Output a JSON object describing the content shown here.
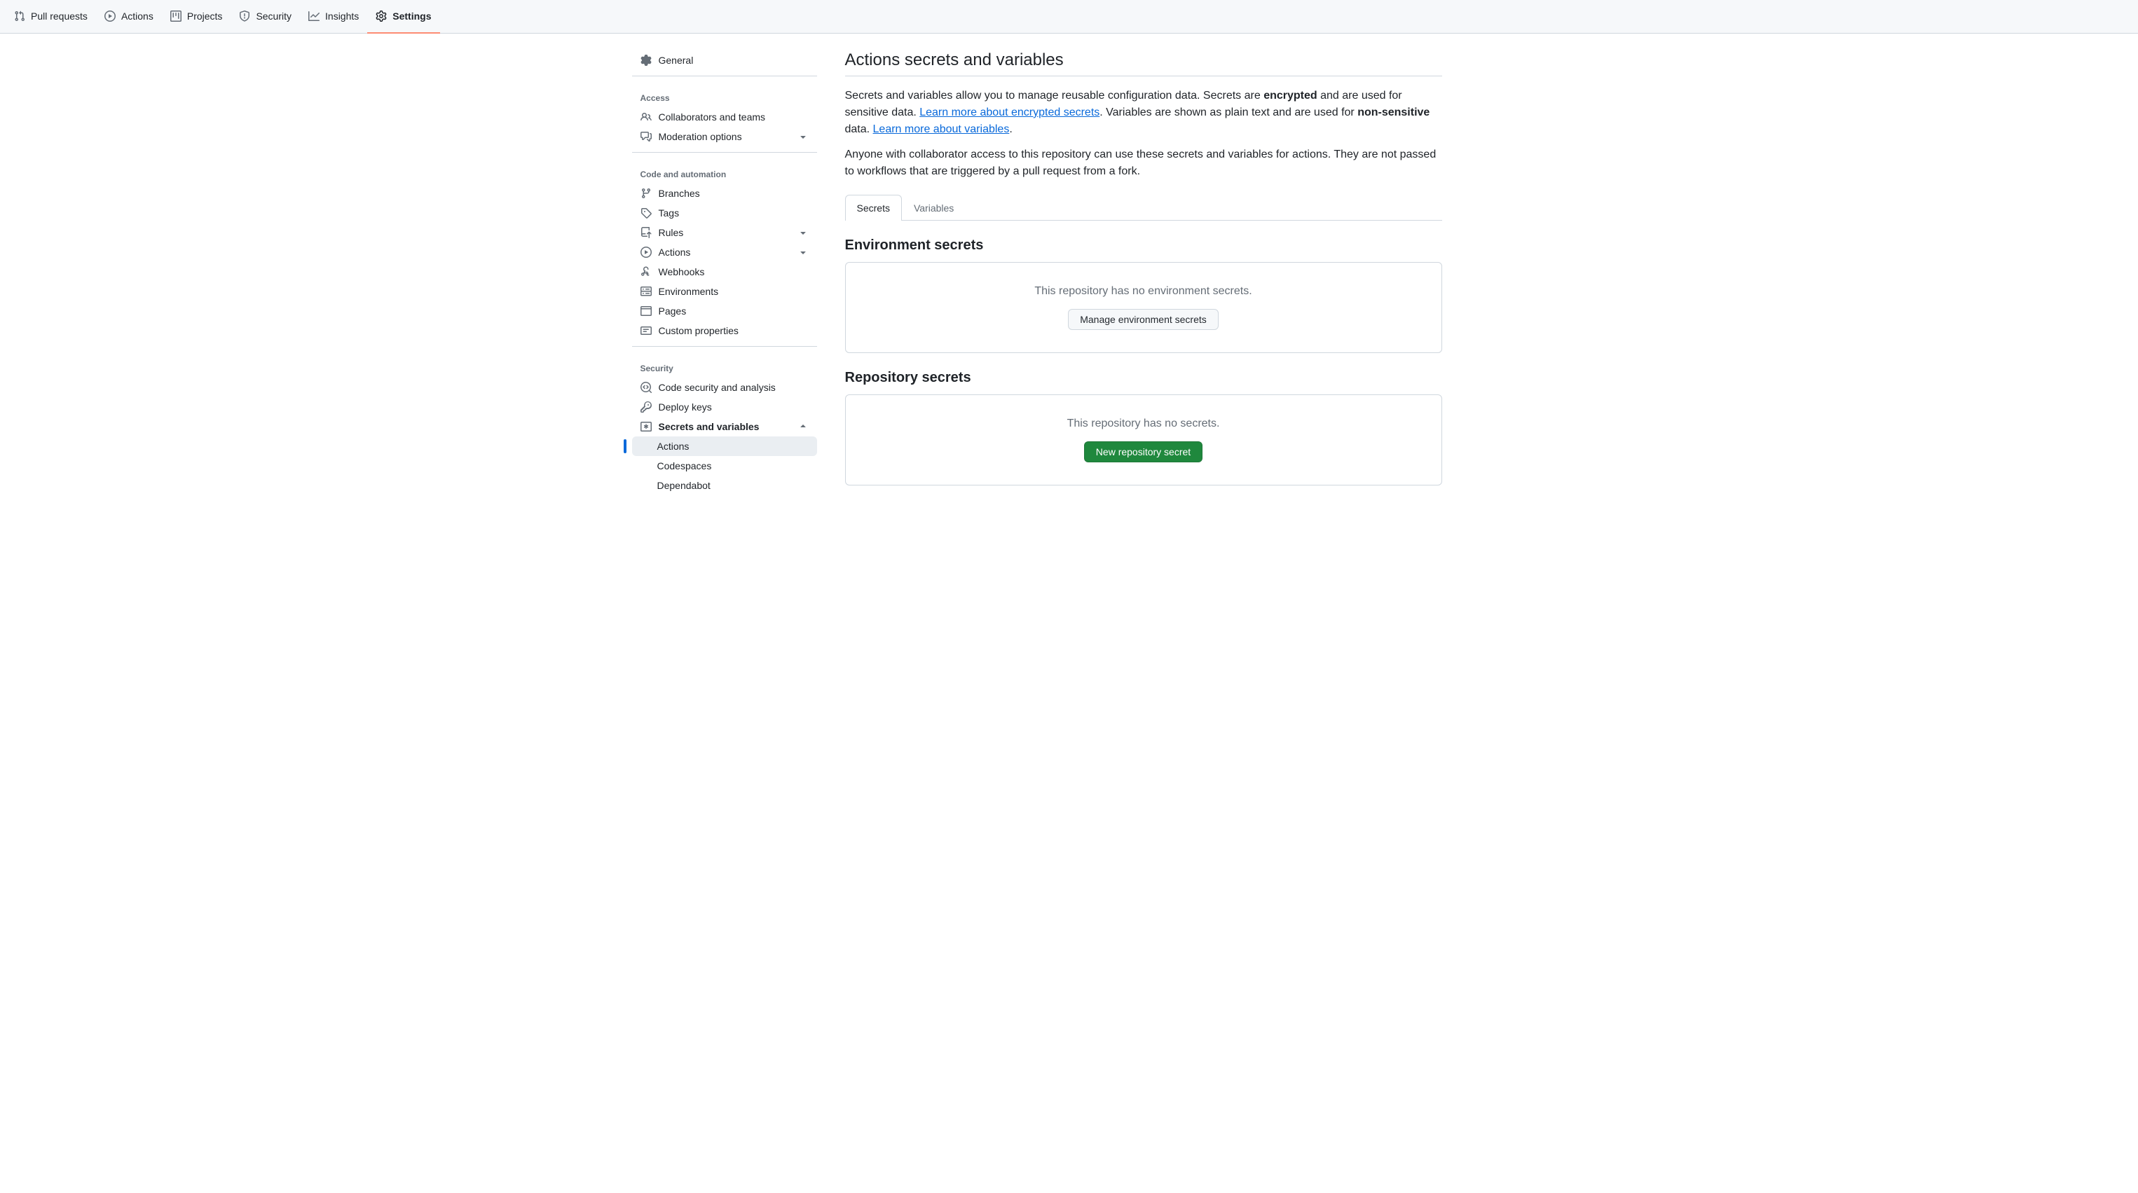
{
  "topnav": {
    "pull_requests": "Pull requests",
    "actions": "Actions",
    "projects": "Projects",
    "security": "Security",
    "insights": "Insights",
    "settings": "Settings"
  },
  "sidebar": {
    "general": "General",
    "group_access": "Access",
    "collaborators": "Collaborators and teams",
    "moderation": "Moderation options",
    "group_code": "Code and automation",
    "branches": "Branches",
    "tags": "Tags",
    "rules": "Rules",
    "actions": "Actions",
    "webhooks": "Webhooks",
    "environments": "Environments",
    "pages": "Pages",
    "custom_properties": "Custom properties",
    "group_security": "Security",
    "code_security": "Code security and analysis",
    "deploy_keys": "Deploy keys",
    "secrets_vars": "Secrets and variables",
    "sv_actions": "Actions",
    "sv_codespaces": "Codespaces",
    "sv_dependabot": "Dependabot"
  },
  "main": {
    "title": "Actions secrets and variables",
    "p1_a": "Secrets and variables allow you to manage reusable configuration data. Secrets are ",
    "p1_enc": "encrypted",
    "p1_b": " and are used for sensitive data. ",
    "link_secrets": "Learn more about encrypted secrets",
    "p1_c": ". Variables are shown as plain text and are used for ",
    "p1_ns": "non-sensitive",
    "p1_d": " data. ",
    "link_vars": "Learn more about variables",
    "p1_e": ".",
    "p2": "Anyone with collaborator access to this repository can use these secrets and variables for actions. They are not passed to workflows that are triggered by a pull request from a fork.",
    "tab_secrets": "Secrets",
    "tab_variables": "Variables",
    "env_title": "Environment secrets",
    "env_empty": "This repository has no environment secrets.",
    "env_btn": "Manage environment secrets",
    "repo_title": "Repository secrets",
    "repo_empty": "This repository has no secrets.",
    "repo_btn": "New repository secret"
  }
}
